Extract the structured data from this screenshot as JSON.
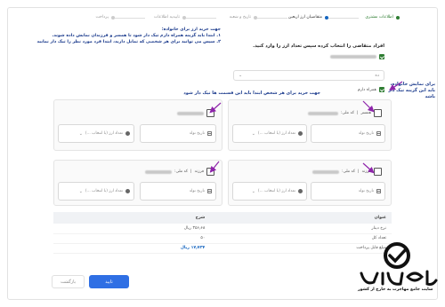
{
  "stepper": [
    {
      "label": "اطلاعات مشتری",
      "state": "done"
    },
    {
      "label": "متقاضیان ارز اربعین",
      "state": "active"
    },
    {
      "label": "تاریخ و شعبه",
      "state": "pending"
    },
    {
      "label": "تاییدیه اطلاعات",
      "state": "pending"
    },
    {
      "label": "پرداخت",
      "state": "pending"
    }
  ],
  "note": {
    "title": "جهت خرید ارز برای خانواده:",
    "line1": "۱. ابتدا باید گزینه همراه دارم تیک دار شود تا همسر و فرزندان نمایش داده شوند.",
    "line2": "۲. سپس می توانید برای هر شخصی که تمایل دارید، ابتدا فرد مورد نظر را تیک دار نمایید"
  },
  "question": "افراد متقاضی را انتخاب کرده سپس تعداد ارز را وارد کنید.",
  "applicant_select_value": "ده",
  "companion_label": "همراه دارم",
  "side_note": "برای نمایش خانواده، باید این گزینه تیک دار باشد",
  "member_note": "جهت خرید برای هر شخص ابتدا باید این قسمت ها تیک دار شود",
  "members": [
    {
      "relation": "همسر",
      "code_label": "کد ملی:"
    },
    {
      "relation": "",
      "code_label": ""
    },
    {
      "relation": "فرزند",
      "code_label": "کد ملی:"
    },
    {
      "relation": "فرزند",
      "code_label": "کد ملی:"
    }
  ],
  "fields": {
    "birth_date": "تاریخ تولد",
    "currency_placeholder": "تعداد ارز (با انتخاب ...)"
  },
  "table": {
    "col_title": "عنوان",
    "col_desc": "شرح",
    "rows": [
      {
        "title": "نرخ دینار",
        "desc": "۳۵۶٫۶۸",
        "unit": "ریال",
        "highlight": false
      },
      {
        "title": "تعداد کل",
        "desc": "۵۰",
        "unit": "",
        "highlight": false
      },
      {
        "title": "مبلغ قابل پرداخت",
        "desc": "۱۷٫۷۳۴",
        "unit": "ریال",
        "highlight": true
      }
    ]
  },
  "buttons": {
    "confirm": "تایید",
    "back": "بازگشت"
  },
  "logo": {
    "brand": "اپلای تو",
    "tagline": "سایت جامع مهاجرت به خارج از کشور"
  },
  "colors": {
    "accent": "#2f6fe4",
    "arrow": "#8e24aa",
    "success": "#2e7d32",
    "note": "#1a3a8c"
  }
}
